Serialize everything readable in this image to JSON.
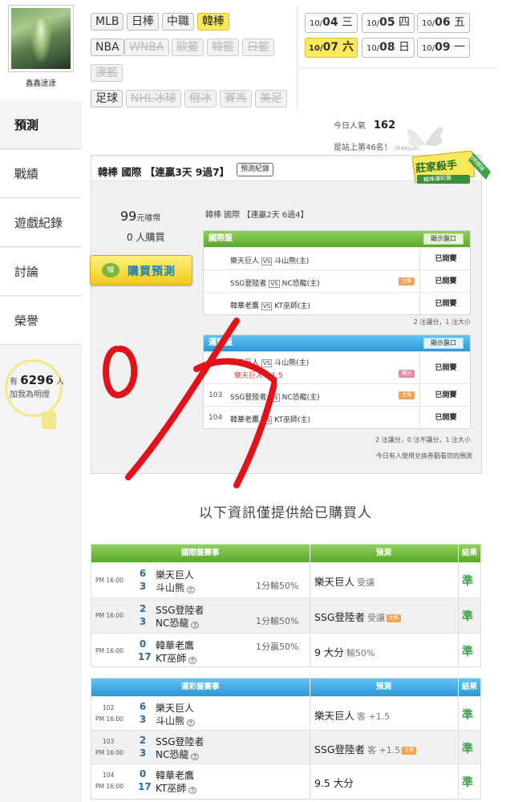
{
  "user": {
    "name": "鑫鑫達達"
  },
  "sidebar": {
    "tabs": [
      {
        "label": "預測",
        "active": true
      },
      {
        "label": "戰績"
      },
      {
        "label": "遊戲紀錄"
      },
      {
        "label": "討論"
      },
      {
        "label": "榮譽"
      }
    ],
    "fans": {
      "prefix": "有",
      "count": "6296",
      "suffix": "人",
      "cta": "加我為明燈"
    }
  },
  "categories": [
    {
      "label": "MLB",
      "state": "normal"
    },
    {
      "label": "日棒",
      "state": "normal"
    },
    {
      "label": "中職",
      "state": "normal"
    },
    {
      "label": "韓棒",
      "state": "selected"
    },
    {
      "label": "NBA",
      "state": "normal"
    },
    {
      "label": "WNBA",
      "state": "disabled"
    },
    {
      "label": "歐籃",
      "state": "disabled"
    },
    {
      "label": "韓籃",
      "state": "disabled"
    },
    {
      "label": "日籃",
      "state": "disabled"
    },
    {
      "label": "澳籃",
      "state": "disabled"
    },
    {
      "label": "足球",
      "state": "normal"
    },
    {
      "label": "NHL冰球",
      "state": "disabled"
    },
    {
      "label": "俄冰",
      "state": "disabled"
    },
    {
      "label": "賽馬",
      "state": "disabled"
    },
    {
      "label": "美足",
      "state": "disabled"
    }
  ],
  "dates": [
    {
      "month": "10/",
      "day": "04",
      "weekday": "三"
    },
    {
      "month": "10/",
      "day": "05",
      "weekday": "四"
    },
    {
      "month": "10/",
      "day": "06",
      "weekday": "五"
    },
    {
      "month": "10/",
      "day": "07",
      "weekday": "六",
      "selected": true
    },
    {
      "month": "10/",
      "day": "08",
      "weekday": "日"
    },
    {
      "month": "10/",
      "day": "09",
      "weekday": "一"
    }
  ],
  "stats": {
    "popularity_label": "今日人氣",
    "popularity": "162",
    "rank": "是站上第46名！",
    "rank_small": "(R4essA)"
  },
  "panel": {
    "title": "韓棒 國際 【連贏3天 9過7】",
    "record_btn": "預測紀錄",
    "badge_title": "莊家殺手",
    "badge_sub": "韓棒運彩盤",
    "badge_ribbon": "說明釋疑",
    "price": "99",
    "price_unit": "元噱幣",
    "buyers": "0 人購買",
    "buy_btn": "購買預測",
    "buy_icon": "噱",
    "subtitle": "韓棒 國際 【連贏2天 6過4】",
    "intl": {
      "header": "國際盤",
      "show": "顯示盤口",
      "rows": [
        {
          "home": "樂天巨人",
          "away": "斗山熊(主)",
          "status": "已開賽",
          "tag": ""
        },
        {
          "home": "SSG登陸者",
          "away": "NC恐龍(主)",
          "status": "已開賽",
          "tag": "主推"
        },
        {
          "home": "韓華老鷹",
          "away": "KT巫師(主)",
          "status": "已開賽",
          "tag": ""
        }
      ],
      "note": "2 注讓分，1 注大小"
    },
    "lottery": {
      "header": "運彩盤",
      "show": "顯示盤口",
      "rows": [
        {
          "no": "102",
          "home": "樂天巨人",
          "away": "斗山熊(主)",
          "pick": "樂天巨人 +1.5",
          "status": "已開賽",
          "tag": "讓分"
        },
        {
          "no": "103",
          "home": "SSG登陸者",
          "away": "NC恐龍(主)",
          "status": "已開賽",
          "tag": "主推"
        },
        {
          "no": "104",
          "home": "韓華老鷹",
          "away": "KT巫師(主)",
          "status": "已開賽",
          "tag": ""
        }
      ],
      "note": "2 注讓分，0 注不讓分，1 注大小",
      "note2": "今日有人使用兌換券觀看您的預測"
    }
  },
  "info_headline": "以下資訊僅提供給已購買人",
  "intl_results": {
    "headers": [
      "國際盤賽事",
      "預測",
      "結果"
    ],
    "rows": [
      {
        "time": "PM 16:00",
        "s1": "6",
        "s2": "3",
        "t1": "樂天巨人",
        "t2": "斗山熊",
        "home": "主",
        "line": "1分輸50%",
        "pick": "樂天巨人",
        "pick_note": "受讓",
        "tag": "",
        "result": "準"
      },
      {
        "time": "PM 16:00",
        "s1": "2",
        "s2": "3",
        "t1": "SSG登陸者",
        "t2": "NC恐龍",
        "home": "主",
        "line": "1分輸50%",
        "pick": "SSG登陸者",
        "pick_note": "受讓",
        "tag": "主推",
        "result": "準"
      },
      {
        "time": "PM 16:00",
        "s1": "0",
        "s2": "17",
        "t1": "韓華老鷹",
        "t2": "KT巫師",
        "home": "主",
        "line": "1分贏50%",
        "pick": "9 大分",
        "pick_note": "輸50%",
        "tag": "",
        "result": "準"
      }
    ]
  },
  "lottery_results": {
    "headers": [
      "運彩盤賽事",
      "預測",
      "結果"
    ],
    "rows": [
      {
        "no": "102",
        "time": "PM 16:00",
        "s1": "6",
        "s2": "3",
        "t1": "樂天巨人",
        "t2": "斗山熊",
        "home": "主",
        "pick": "樂天巨人",
        "pick_note": "客 +1.5",
        "tag": "",
        "result": "準"
      },
      {
        "no": "103",
        "time": "PM 16:00",
        "s1": "2",
        "s2": "3",
        "t1": "SSG登陸者",
        "t2": "NC恐龍",
        "home": "主",
        "pick": "SSG登陸者",
        "pick_note": "客 +1.5",
        "tag": "主推",
        "result": "準"
      },
      {
        "no": "104",
        "time": "PM 16:00",
        "s1": "0",
        "s2": "17",
        "t1": "韓華老鷹",
        "t2": "KT巫師",
        "home": "主",
        "pick": "9.5 大分",
        "pick_note": "",
        "tag": "",
        "result": "準"
      }
    ]
  },
  "colors": {
    "accent_yellow": "#fbe85b",
    "green": "#5aa82a",
    "blue": "#2d97d6",
    "ink": "#e3111a",
    "win": "#3aa34a"
  }
}
